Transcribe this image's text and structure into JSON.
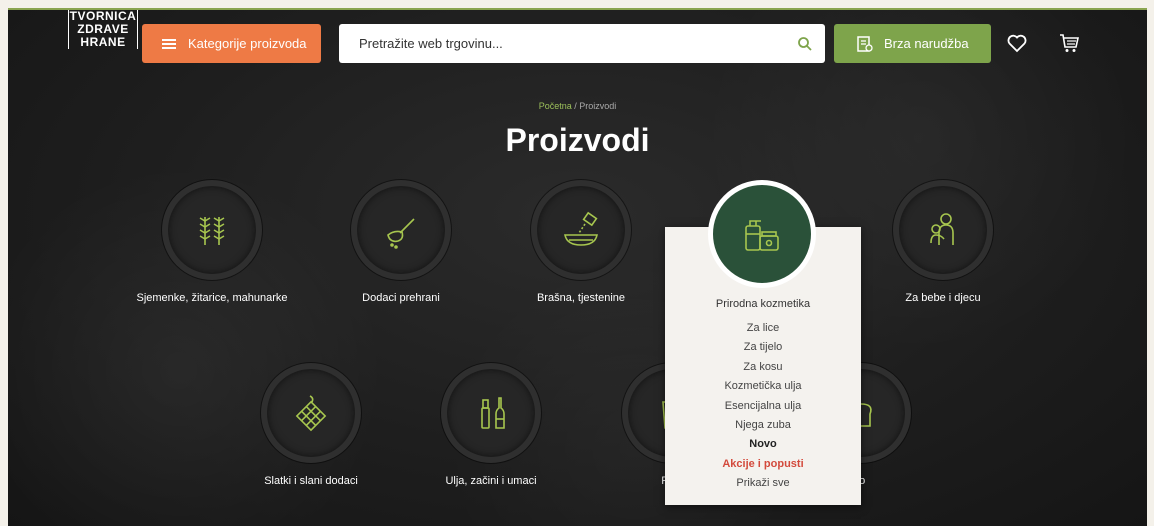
{
  "header": {
    "logo_lines": [
      "TVORNICA",
      "ZDRAVE",
      "HRANE"
    ],
    "categories_button": "Kategorije proizvoda",
    "search_placeholder": "Pretražite web trgovinu...",
    "quick_order_button": "Brza narudžba"
  },
  "breadcrumb": {
    "home": "Početna",
    "separator": "/",
    "current": "Proizvodi"
  },
  "page_title": "Proizvodi",
  "categories_row1": [
    {
      "label": "Sjemenke, žitarice, mahunarke",
      "icon": "wheat-icon"
    },
    {
      "label": "Dodaci prehrani",
      "icon": "spoon-icon"
    },
    {
      "label": "Brašna, tjestenine",
      "icon": "flour-bowl-icon"
    },
    {
      "label": "Prirodna kozmetika",
      "icon": "cosmetics-icon"
    },
    {
      "label": "Za bebe i djecu",
      "icon": "mother-baby-icon"
    }
  ],
  "categories_row2": [
    {
      "label": "Slatki i slani dodaci",
      "icon": "chocolate-icon"
    },
    {
      "label": "Ulja, začini i umaci",
      "icon": "bottles-icon"
    },
    {
      "label": "Pića",
      "icon": "drinks-icon"
    },
    {
      "label": "lo",
      "icon": "bakery-icon"
    }
  ],
  "dropdown": {
    "title": "Prirodna kozmetika",
    "items": [
      "Za lice",
      "Za tijelo",
      "Za kosu",
      "Kozmetička ulja",
      "Esencijalna ulja",
      "Njega zuba"
    ],
    "new_label": "Novo",
    "sale_label": "Akcije i popusti",
    "show_all": "Prikaži sve"
  },
  "colors": {
    "accent_orange": "#ee7a45",
    "accent_green": "#7ea44b",
    "icon_green": "#a7c64f",
    "dropdown_circle": "#2a5139",
    "sale_red": "#d34a3c"
  }
}
